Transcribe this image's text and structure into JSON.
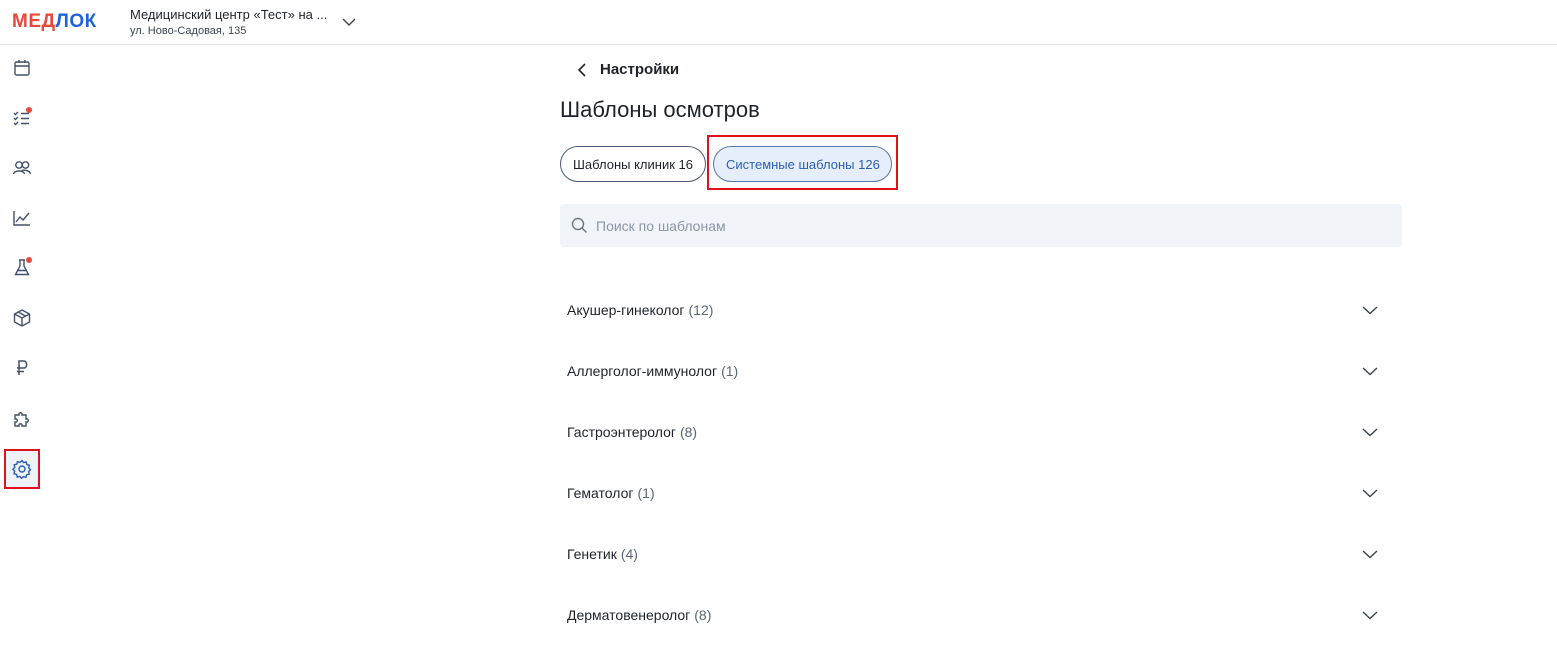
{
  "header": {
    "logo_red": "МЕД",
    "logo_blue": "ЛОК",
    "clinic_name": "Медицинский центр «Тест» на ...",
    "clinic_address": "ул. Ново-Садовая, 135"
  },
  "sidebar": {
    "items": [
      {
        "name": "calendar-icon",
        "badge": false
      },
      {
        "name": "tasks-icon",
        "badge": true
      },
      {
        "name": "patients-icon",
        "badge": false
      },
      {
        "name": "analytics-icon",
        "badge": false
      },
      {
        "name": "lab-flask-icon",
        "badge": true
      },
      {
        "name": "box-icon",
        "badge": false
      },
      {
        "name": "ruble-icon",
        "badge": false
      },
      {
        "name": "puzzle-icon",
        "badge": false
      },
      {
        "name": "settings-gear-icon",
        "badge": false,
        "active": true
      }
    ]
  },
  "main": {
    "back_label": "Настройки",
    "title": "Шаблоны осмотров",
    "tabs": [
      {
        "label": "Шаблоны клиник 16",
        "selected": false
      },
      {
        "label": "Системные шаблоны 126",
        "selected": true
      }
    ],
    "search_placeholder": "Поиск по шаблонам",
    "categories": [
      {
        "name": "Акушер-гинеколог",
        "count": "(12)"
      },
      {
        "name": "Аллерголог-иммунолог",
        "count": "(1)"
      },
      {
        "name": "Гастроэнтеролог",
        "count": "(8)"
      },
      {
        "name": "Гематолог",
        "count": "(1)"
      },
      {
        "name": "Генетик",
        "count": "(4)"
      },
      {
        "name": "Дерматовенеролог",
        "count": "(8)"
      }
    ]
  },
  "colors": {
    "accent_blue": "#2c5fb4",
    "logo_red": "#e8483a",
    "highlight_red": "#e0111e"
  }
}
